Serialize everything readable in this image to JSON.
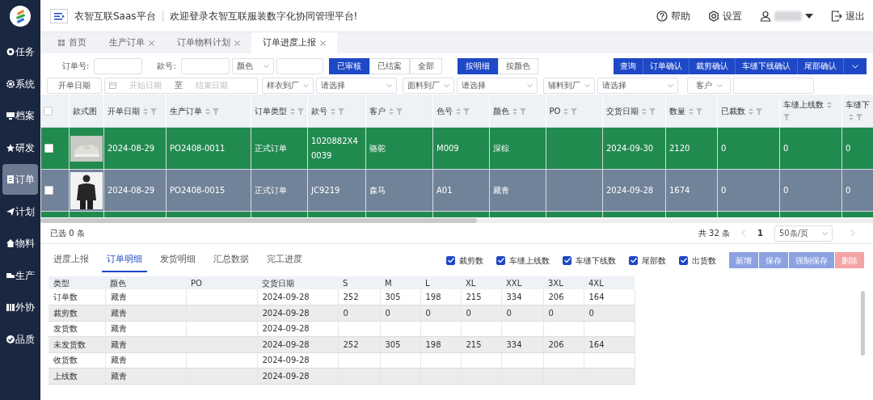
{
  "header": {
    "app_name": "衣智互联Saas平台",
    "welcome": "欢迎登录衣智互联服装数字化协同管理平台!",
    "actions": [
      {
        "kind": "help",
        "label": "帮助"
      },
      {
        "kind": "settings",
        "label": "设置"
      },
      {
        "kind": "user"
      },
      {
        "kind": "logout",
        "label": "退出"
      }
    ]
  },
  "sidebar": {
    "items": [
      {
        "label": "任务",
        "selected": false
      },
      {
        "label": "系统",
        "selected": false
      },
      {
        "label": "档案",
        "selected": false
      },
      {
        "label": "研发",
        "selected": false
      },
      {
        "label": "订单",
        "selected": true
      },
      {
        "label": "计划",
        "selected": false
      },
      {
        "label": "物料",
        "selected": false
      },
      {
        "label": "生产",
        "selected": false
      },
      {
        "label": "外协",
        "selected": false
      },
      {
        "label": "品质",
        "selected": false
      }
    ]
  },
  "tabs": [
    {
      "label": "首页",
      "closable": false,
      "selected": false
    },
    {
      "label": "生产订单",
      "closable": true,
      "selected": false
    },
    {
      "label": "订单物料计划",
      "closable": true,
      "selected": false
    },
    {
      "label": "订单进度上报",
      "closable": true,
      "selected": true
    }
  ],
  "filters": {
    "order_no_label": "订单号:",
    "style_no_label": "款号:",
    "color_select": "颜色",
    "status": [
      {
        "label": "已审核",
        "selected": true
      },
      {
        "label": "已结案",
        "selected": false
      },
      {
        "label": "全部",
        "selected": false
      }
    ],
    "view": [
      {
        "label": "按明细",
        "selected": true
      },
      {
        "label": "按颜色",
        "selected": false
      }
    ],
    "actions": [
      "查询",
      "订单确认",
      "裁剪确认",
      "车缝下线确认",
      "尾部确认"
    ],
    "date_label": "开单日期",
    "date_start_placeholder": "开始日期",
    "date_to": "至",
    "date_end_placeholder": "结束日期",
    "selects": [
      {
        "label": "样衣到厂",
        "placeholder": "请选择"
      },
      {
        "label": "面料到厂",
        "placeholder": "请选择"
      },
      {
        "label": "辅料到厂",
        "placeholder": "请选择"
      }
    ],
    "customer_label": "客户"
  },
  "table": {
    "all_checked": false,
    "columns": [
      {
        "label": "款式图",
        "sortable": false
      },
      {
        "label": "开单日期",
        "sortable": true
      },
      {
        "label": "生产订单",
        "sortable": true
      },
      {
        "label": "订单类型",
        "sortable": true
      },
      {
        "label": "款号",
        "sortable": true
      },
      {
        "label": "客户",
        "sortable": true
      },
      {
        "label": "色号",
        "sortable": true
      },
      {
        "label": "颜色",
        "sortable": true
      },
      {
        "label": "PO",
        "sortable": true
      },
      {
        "label": "交货日期",
        "sortable": true
      },
      {
        "label": "数量",
        "sortable": true
      },
      {
        "label": "已裁数",
        "sortable": true
      },
      {
        "label": "车缝上线数",
        "sortable": true
      },
      {
        "label": "车缝下",
        "sortable": true
      }
    ],
    "rows": [
      {
        "selected": false,
        "checked": false,
        "cells": [
          "",
          "2024-08-29",
          "PO2408-0011",
          "正式订单",
          "1020882X40039",
          "骆驼",
          "M009",
          "深棕",
          "",
          "2024-09-30",
          "2120",
          "0",
          "0",
          "0"
        ]
      },
      {
        "selected": true,
        "checked": false,
        "cells": [
          "",
          "2024-08-29",
          "PO2408-0015",
          "正式订单",
          "JC9219",
          "森马",
          "A01",
          "藏青",
          "",
          "2024-09-28",
          "1674",
          "0",
          "0",
          "0"
        ]
      }
    ]
  },
  "footer": {
    "selected_count": "已选 0 条",
    "total": "共 32 条",
    "page": "1",
    "page_size": "50条/页"
  },
  "detail": {
    "tabs": [
      {
        "label": "进度上报",
        "selected": false
      },
      {
        "label": "订单明细",
        "selected": true
      },
      {
        "label": "发货明细",
        "selected": false
      },
      {
        "label": "汇总数据",
        "selected": false
      },
      {
        "label": "完工进度",
        "selected": false
      }
    ],
    "toggles": [
      {
        "label": "裁剪数",
        "checked": true
      },
      {
        "label": "车缝上线数",
        "checked": true
      },
      {
        "label": "车缝下线数",
        "checked": true
      },
      {
        "label": "尾部数",
        "checked": true
      },
      {
        "label": "出货数",
        "checked": true
      }
    ],
    "buttons": [
      {
        "label": "新增",
        "kind": "primary",
        "disabled": true
      },
      {
        "label": "保存",
        "kind": "primary",
        "disabled": true
      },
      {
        "label": "强制保存",
        "kind": "primary",
        "disabled": true
      },
      {
        "label": "删除",
        "kind": "danger",
        "disabled": true
      }
    ],
    "columns": [
      "类型",
      "颜色",
      "PO",
      "交货日期",
      "S",
      "M",
      "L",
      "XL",
      "XXL",
      "3XL",
      "4XL"
    ],
    "rows": [
      [
        "订单数",
        "藏青",
        "",
        "2024-09-28",
        "252",
        "305",
        "198",
        "215",
        "334",
        "206",
        "164"
      ],
      [
        "裁剪数",
        "藏青",
        "",
        "2024-09-28",
        "0",
        "0",
        "0",
        "0",
        "0",
        "0",
        "0"
      ],
      [
        "发货数",
        "藏青",
        "",
        "2024-09-28",
        "",
        "",
        "",
        "",
        "",
        "",
        ""
      ],
      [
        "未发货数",
        "藏青",
        "",
        "2024-09-28",
        "252",
        "305",
        "198",
        "215",
        "334",
        "206",
        "164"
      ],
      [
        "收货数",
        "藏青",
        "",
        "2024-09-28",
        "",
        "",
        "",
        "",
        "",
        "",
        ""
      ],
      [
        "上线数",
        "藏青",
        "",
        "2024-09-28",
        "",
        "",
        "",
        "",
        "",
        "",
        ""
      ]
    ]
  }
}
